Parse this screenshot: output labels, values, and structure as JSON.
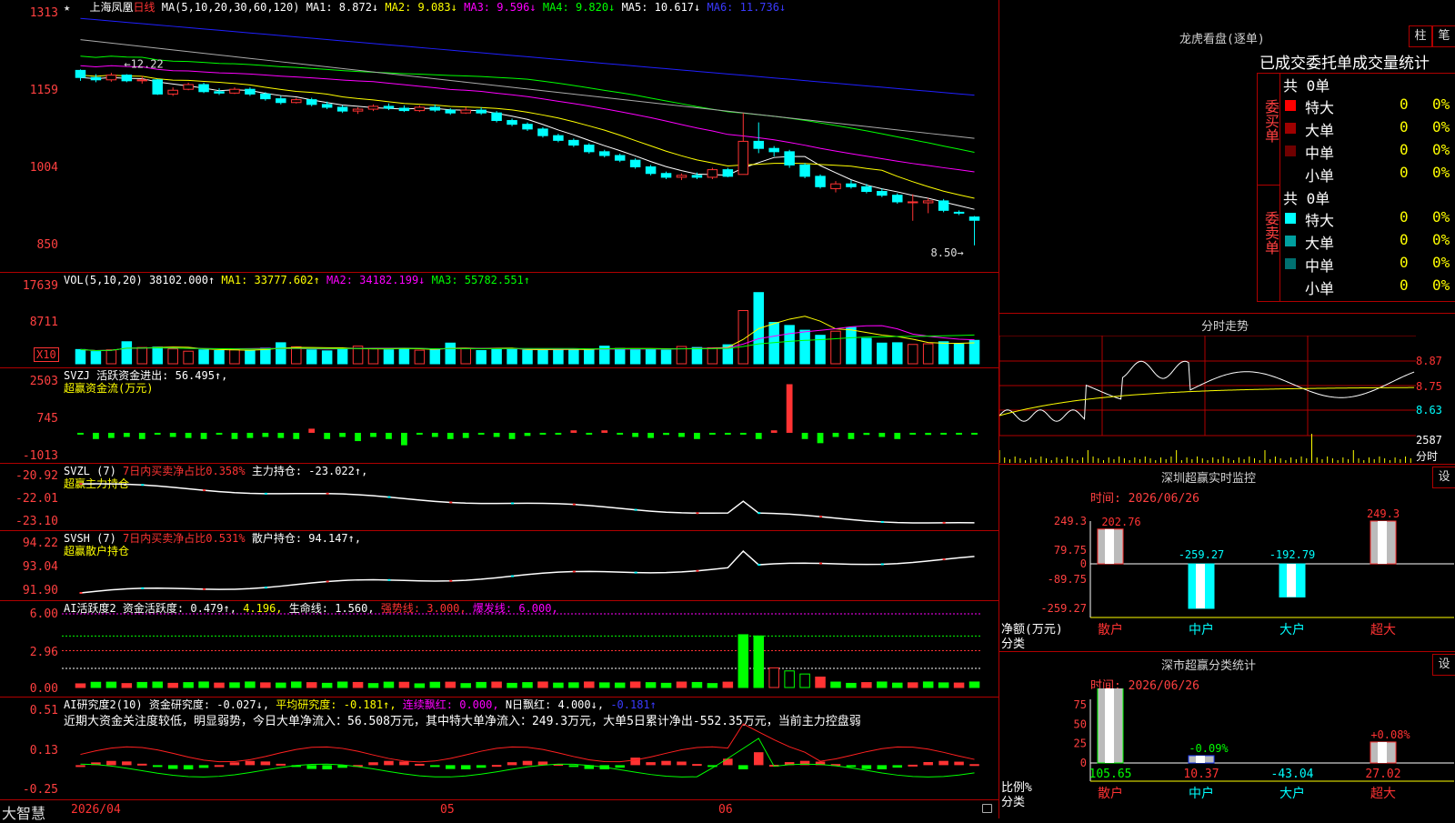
{
  "colors": {
    "up": "#ff3333",
    "down": "#00ffff",
    "grid": "#b00000",
    "ma1": "#ffffff",
    "ma2": "#ffff00",
    "ma3": "#ff00ff",
    "ma4": "#00ff00",
    "ma5": "#aaaaaa",
    "ma6": "#2020ff",
    "yellow": "#ffff00",
    "label": "#ff4040"
  },
  "main": {
    "star": "★",
    "stock": "上海凤凰",
    "period": "日线",
    "ma_label": "MA(5,10,20,30,60,120)",
    "ma1": "MA1: 8.872↓",
    "ma2": "MA2: 9.083↓",
    "ma3": "MA3: 9.596↓",
    "ma4": "MA4: 9.820↓",
    "ma5": "MA5: 10.617↓",
    "ma6": "MA6: 11.736↓",
    "ticks": [
      "1313",
      "1159",
      "1004",
      "850"
    ],
    "high_label": "12.22",
    "low_label": "8.50"
  },
  "vol": {
    "label": "VOL(5,10,20)",
    "v": "38102.000↑",
    "ma1": "MA1: 33777.602↑",
    "ma2": "MA2: 34182.199↓",
    "ma3": "MA3: 55782.551↑",
    "ticks": [
      "17639",
      "8711"
    ],
    "unit": "X10"
  },
  "svzj": {
    "label": "SVZJ  活跃资金进出:",
    "value": "56.495↑,",
    "sub": "超赢资金流(万元)",
    "ticks": [
      "2503",
      "745",
      "-1013"
    ]
  },
  "svzl": {
    "label": "SVZL (7)",
    "red": "7日内买卖净占比0.358%",
    "main": "主力持仓: -23.022↑,",
    "sub": "超赢主力持仓",
    "ticks": [
      "-20.92",
      "-22.01",
      "-23.10"
    ]
  },
  "svsh": {
    "label": "SVSH (7)",
    "red": "7日内买卖净占比0.531%",
    "main": "散户持仓: 94.147↑,",
    "sub": "超赢散户持仓",
    "ticks": [
      "94.22",
      "93.04",
      "91.90"
    ]
  },
  "ai1": {
    "label": "AI活跃度2",
    "a": "资金活跃度: 0.479↑,",
    "b": "4.196,",
    "c": "生命线: 1.560,",
    "d": "强势线: 3.000,",
    "e": "爆发线: 6.000,",
    "ticks": [
      "6.00",
      "2.96",
      "0.00"
    ]
  },
  "ai2": {
    "label": "AI研究度2(10)",
    "a": "资金研究度: -0.027↓,",
    "b": "平均研究度: -0.181↑,",
    "c": "连续飘红: 0.000,",
    "d": "N日飘红: 4.000↓,",
    "e": "-0.181↑",
    "comment": "近期大资金关注度较低，明显弱势，今日大单净流入：56.508万元，其中特大单净流入：249.3万元，大单5日累计净出-552.35万元，当前主力控盘弱",
    "ticks": [
      "0.51",
      "0.13",
      "-0.25"
    ]
  },
  "xaxis": {
    "d1": "2026/04",
    "d2": "05",
    "d3": "06"
  },
  "footer": {
    "brand": "大智慧"
  },
  "lhb": {
    "title": "龙虎看盘(逐单)",
    "btn1": "柱",
    "btn2": "笔",
    "header": "已成交委托单成交量统计",
    "buy": {
      "side": "委买单",
      "total": "共 0单",
      "rows": [
        {
          "name": "特大",
          "v": "0",
          "p": "0%",
          "c": "#ff0000"
        },
        {
          "name": "大单",
          "v": "0",
          "p": "0%",
          "c": "#a00000"
        },
        {
          "name": "中单",
          "v": "0",
          "p": "0%",
          "c": "#700000"
        },
        {
          "name": "小单",
          "v": "0",
          "p": "0%",
          "c": "#000000"
        }
      ]
    },
    "sell": {
      "side": "委卖单",
      "total": "共 0单",
      "rows": [
        {
          "name": "特大",
          "v": "0",
          "p": "0%",
          "c": "#00ffff"
        },
        {
          "name": "大单",
          "v": "0",
          "p": "0%",
          "c": "#00a0a0"
        },
        {
          "name": "中单",
          "v": "0",
          "p": "0%",
          "c": "#007070"
        },
        {
          "name": "小单",
          "v": "0",
          "p": "0%",
          "c": "#000000"
        }
      ]
    }
  },
  "fenshi": {
    "title": "分时走势",
    "ticks": [
      "8.87",
      "8.75",
      "8.63"
    ],
    "vol_tick": "2587",
    "unit": "分时"
  },
  "monitor": {
    "title": "深圳超赢实时监控",
    "btn": "设",
    "time": "时间: 2026/06/26",
    "ylabel": "净额(万元)",
    "xlabel": "分类",
    "yticks": [
      "249.3",
      "79.75",
      "0",
      "-89.75",
      "-259.27"
    ]
  },
  "stats": {
    "title": "深市超赢分类统计",
    "btn": "设",
    "time": "时间: 2026/06/26",
    "ylabel": "比例%",
    "xlabel": "分类",
    "yticks": [
      "75",
      "50",
      "25",
      "0"
    ]
  },
  "chart_data": [
    {
      "type": "candlestick",
      "title": "上海凤凰 日线",
      "ylim": [
        8.4,
        13.4
      ],
      "ticks": [
        "13.13",
        "11.59",
        "10.04",
        "8.50"
      ],
      "x": [
        "2026/04",
        "05",
        "06"
      ],
      "ohlc": [
        [
          12.2,
          12.05,
          12.22,
          11.98
        ],
        [
          12.05,
          12.0,
          12.12,
          11.95
        ],
        [
          12.0,
          12.1,
          12.15,
          11.96
        ],
        [
          12.1,
          11.98,
          12.12,
          11.95
        ],
        [
          11.98,
          12.0,
          12.08,
          11.92
        ],
        [
          12.0,
          11.7,
          12.02,
          11.68
        ],
        [
          11.7,
          11.78,
          11.84,
          11.66
        ],
        [
          11.8,
          11.9,
          11.94,
          11.78
        ],
        [
          11.9,
          11.75,
          11.94,
          11.72
        ],
        [
          11.75,
          11.72,
          11.82,
          11.68
        ],
        [
          11.72,
          11.8,
          11.84,
          11.7
        ],
        [
          11.8,
          11.7,
          11.84,
          11.66
        ],
        [
          11.7,
          11.6,
          11.74,
          11.56
        ],
        [
          11.6,
          11.52,
          11.66,
          11.48
        ],
        [
          11.52,
          11.58,
          11.62,
          11.5
        ],
        [
          11.58,
          11.48,
          11.62,
          11.44
        ],
        [
          11.48,
          11.42,
          11.54,
          11.38
        ],
        [
          11.42,
          11.34,
          11.46,
          11.3
        ],
        [
          11.34,
          11.38,
          11.42,
          11.28
        ],
        [
          11.38,
          11.44,
          11.48,
          11.34
        ],
        [
          11.44,
          11.4,
          11.5,
          11.36
        ],
        [
          11.4,
          11.35,
          11.46,
          11.32
        ],
        [
          11.35,
          11.42,
          11.46,
          11.32
        ],
        [
          11.42,
          11.36,
          11.48,
          11.32
        ],
        [
          11.36,
          11.3,
          11.4,
          11.26
        ],
        [
          11.3,
          11.36,
          11.42,
          11.28
        ],
        [
          11.36,
          11.3,
          11.42,
          11.26
        ],
        [
          11.3,
          11.14,
          11.34,
          11.1
        ],
        [
          11.14,
          11.06,
          11.18,
          11.02
        ],
        [
          11.06,
          10.96,
          11.1,
          10.92
        ],
        [
          10.96,
          10.82,
          11.0,
          10.78
        ],
        [
          10.82,
          10.72,
          10.86,
          10.68
        ],
        [
          10.72,
          10.62,
          10.76,
          10.58
        ],
        [
          10.62,
          10.48,
          10.66,
          10.44
        ],
        [
          10.48,
          10.4,
          10.52,
          10.36
        ],
        [
          10.4,
          10.3,
          10.44,
          10.26
        ],
        [
          10.3,
          10.16,
          10.34,
          10.12
        ],
        [
          10.16,
          10.02,
          10.2,
          9.98
        ],
        [
          10.02,
          9.94,
          10.06,
          9.9
        ],
        [
          9.94,
          9.98,
          10.02,
          9.88
        ],
        [
          9.98,
          9.94,
          10.04,
          9.9
        ],
        [
          9.94,
          10.1,
          10.14,
          9.9
        ],
        [
          10.1,
          9.96,
          10.14,
          9.94
        ],
        [
          10.0,
          10.7,
          11.3,
          10.0
        ],
        [
          10.7,
          10.55,
          11.1,
          10.45
        ],
        [
          10.55,
          10.48,
          10.6,
          10.38
        ],
        [
          10.48,
          10.2,
          10.52,
          10.14
        ],
        [
          10.2,
          9.96,
          10.24,
          9.92
        ],
        [
          9.96,
          9.74,
          10.0,
          9.7
        ],
        [
          9.7,
          9.8,
          9.86,
          9.62
        ],
        [
          9.8,
          9.74,
          9.88,
          9.7
        ],
        [
          9.74,
          9.64,
          9.8,
          9.6
        ],
        [
          9.64,
          9.56,
          9.7,
          9.52
        ],
        [
          9.56,
          9.42,
          9.6,
          9.38
        ],
        [
          9.42,
          9.42,
          9.58,
          9.02
        ],
        [
          9.4,
          9.44,
          9.5,
          9.18
        ],
        [
          9.44,
          9.24,
          9.48,
          9.2
        ],
        [
          9.2,
          9.18,
          9.24,
          9.14
        ],
        [
          9.1,
          9.03,
          9.12,
          8.5
        ]
      ]
    },
    {
      "type": "bar",
      "title": "VOL",
      "ylim": [
        0,
        22000
      ],
      "ticks": [
        "17639",
        "8711"
      ],
      "values": [
        4200,
        3600,
        4100,
        6500,
        4800,
        4900,
        4400,
        3700,
        4100,
        3900,
        4300,
        4000,
        4600,
        6200,
        5000,
        4100,
        3800,
        4300,
        5200,
        4500,
        4100,
        4400,
        4000,
        4200,
        6100,
        4500,
        3900,
        4200,
        4400,
        4000,
        4300,
        4100,
        4400,
        4200,
        5200,
        4500,
        4100,
        4400,
        4000,
        5100,
        4800,
        4700,
        5600,
        15700,
        21000,
        12200,
        11300,
        9900,
        8400,
        9600,
        10700,
        7500,
        6100,
        6200,
        5700,
        5900,
        6500,
        5800,
        6900
      ]
    },
    {
      "type": "bar",
      "title": "超赢资金流(万元)",
      "ylim": [
        -1013,
        2503
      ],
      "values": [
        -60,
        -300,
        -250,
        -200,
        -300,
        -60,
        -200,
        -250,
        -300,
        -80,
        -300,
        -250,
        -200,
        -250,
        -300,
        200,
        -300,
        -200,
        -400,
        -200,
        -300,
        -600,
        -60,
        -200,
        -300,
        -250,
        -60,
        -200,
        -300,
        -150,
        -60,
        -60,
        120,
        -80,
        120,
        -80,
        -200,
        -250,
        -100,
        -200,
        -300,
        -60,
        -80,
        -60,
        -300,
        120,
        2350,
        -300,
        -500,
        -200,
        -300,
        -100,
        -200,
        -300,
        -80,
        -100,
        -60,
        -60,
        -60
      ]
    },
    {
      "type": "line",
      "title": "超赢主力持仓",
      "ylim": [
        -23.1,
        -20.92
      ]
    },
    {
      "type": "line",
      "title": "超赢散户持仓",
      "ylim": [
        91.9,
        94.22
      ]
    },
    {
      "type": "bar",
      "title": "AI活跃度2",
      "ylim": [
        0,
        6.0
      ],
      "ticks": [
        "6.00",
        "2.96",
        "0.00"
      ]
    },
    {
      "type": "bar",
      "title": "AI研究度2(10)",
      "ylim": [
        -0.25,
        0.51
      ],
      "ticks": [
        "0.51",
        "0.13",
        "-0.25"
      ]
    },
    {
      "type": "bar",
      "title": "深圳超赢实时监控",
      "categories": [
        "散户",
        "中户",
        "大户",
        "超大"
      ],
      "values": [
        202.76,
        -259.27,
        -192.79,
        249.3
      ],
      "ylim": [
        -259.27,
        249.3
      ]
    },
    {
      "type": "bar",
      "title": "深市超赢分类统计",
      "categories": [
        "散户",
        "中户",
        "大户",
        "超大"
      ],
      "values": [
        105.65,
        10.37,
        -43.04,
        27.02
      ],
      "extra_labels": [
        "",
        "-0.09%",
        "",
        "+0.08%"
      ],
      "ylim": [
        0,
        75
      ]
    }
  ]
}
